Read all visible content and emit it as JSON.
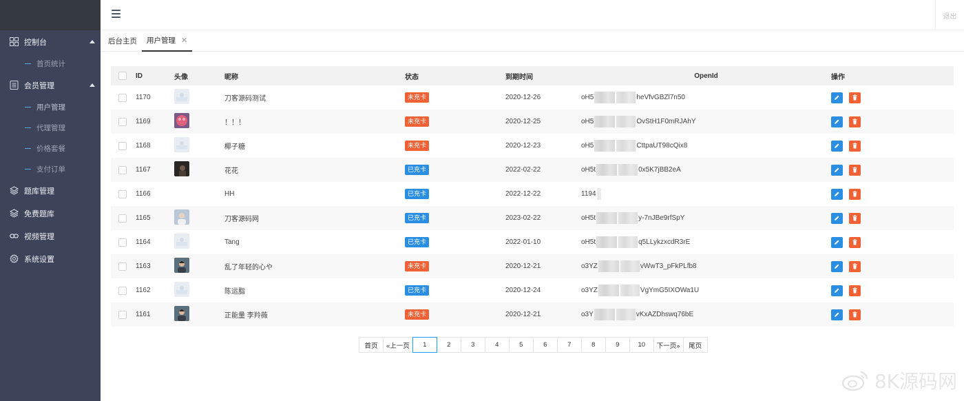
{
  "sidebar": {
    "groups": [
      {
        "label": "控制台",
        "icon": "dashboard-grid-icon",
        "expanded": true,
        "children": [
          "首页统计"
        ]
      },
      {
        "label": "会员管理",
        "icon": "member-list-icon",
        "expanded": true,
        "children": [
          "用户管理",
          "代理管理",
          "价格套餐",
          "支付订单"
        ]
      },
      {
        "label": "题库管理",
        "icon": "layers-icon"
      },
      {
        "label": "免费题库",
        "icon": "layers-icon"
      },
      {
        "label": "视频管理",
        "icon": "link-icon"
      },
      {
        "label": "系统设置",
        "icon": "gear-icon"
      }
    ]
  },
  "header": {
    "logout": "退出"
  },
  "tabs": [
    {
      "label": "后台主页",
      "active": false
    },
    {
      "label": "用户管理",
      "active": true
    }
  ],
  "table": {
    "columns": [
      "ID",
      "头像",
      "昵称",
      "状态",
      "到期时间",
      "OpenId",
      "操作"
    ],
    "rows": [
      {
        "id": "1170",
        "avatar": "placeholder",
        "nickname": "刀客源码测试",
        "status": "未充卡",
        "expiry": "2020-12-26",
        "openid_prefix": "oH5",
        "openid_suffix": "heVfvGBZl7n50"
      },
      {
        "id": "1169",
        "avatar": "pink",
        "nickname": "！！！",
        "status": "未充卡",
        "expiry": "2020-12-25",
        "openid_prefix": "oH5",
        "openid_suffix": "OvStH1F0mRJAhY"
      },
      {
        "id": "1168",
        "avatar": "placeholder",
        "nickname": "椰子糖",
        "status": "未充卡",
        "expiry": "2020-12-23",
        "openid_prefix": "oH5",
        "openid_suffix": "CttpaUT98cQix8"
      },
      {
        "id": "1167",
        "avatar": "dark",
        "nickname": "花花",
        "status": "已充卡",
        "expiry": "2022-02-22",
        "openid_prefix": "oH5t",
        "openid_suffix": "0x5K7jBB2eA"
      },
      {
        "id": "1166",
        "avatar": "none",
        "nickname": "HH",
        "status": "已充卡",
        "expiry": "2022-12-22",
        "openid_prefix": "1194",
        "openid_suffix": ""
      },
      {
        "id": "1165",
        "avatar": "person-light",
        "nickname": "刀客源码网",
        "status": "已充卡",
        "expiry": "2023-02-22",
        "openid_prefix": "oH5t",
        "openid_suffix": "y-7nJBe9rfSpY"
      },
      {
        "id": "1164",
        "avatar": "placeholder",
        "nickname": "Tang",
        "status": "已充卡",
        "expiry": "2022-01-10",
        "openid_prefix": "oH5t",
        "openid_suffix": "q5LLykzxcdR3rE"
      },
      {
        "id": "1163",
        "avatar": "person-dark",
        "nickname": "乱了年轻的心や",
        "status": "未充卡",
        "expiry": "2020-12-21",
        "openid_prefix": "o3YZ",
        "openid_suffix": "vWwT3_pFkPLfb8"
      },
      {
        "id": "1162",
        "avatar": "placeholder",
        "nickname": "陈运脂",
        "status": "已充卡",
        "expiry": "2020-12-24",
        "openid_prefix": "o3YZ",
        "openid_suffix": "VgYmG5IXOWa1U"
      },
      {
        "id": "1161",
        "avatar": "person-dark",
        "nickname": "正能量 李羚薇",
        "status": "未充卡",
        "expiry": "2020-12-21",
        "openid_prefix": "o3Y",
        "openid_suffix": "vKxAZDhswq76bE"
      }
    ]
  },
  "status_colors": {
    "未充卡": "#f06236",
    "已充卡": "#2a8fe3"
  },
  "pagination": {
    "first": "首页",
    "prev": "«上一页",
    "pages": [
      "1",
      "2",
      "3",
      "4",
      "5",
      "6",
      "7",
      "8",
      "9",
      "10"
    ],
    "current": "1",
    "next": "下一页»",
    "last": "尾页"
  },
  "watermark": {
    "text": "8K源码网"
  }
}
